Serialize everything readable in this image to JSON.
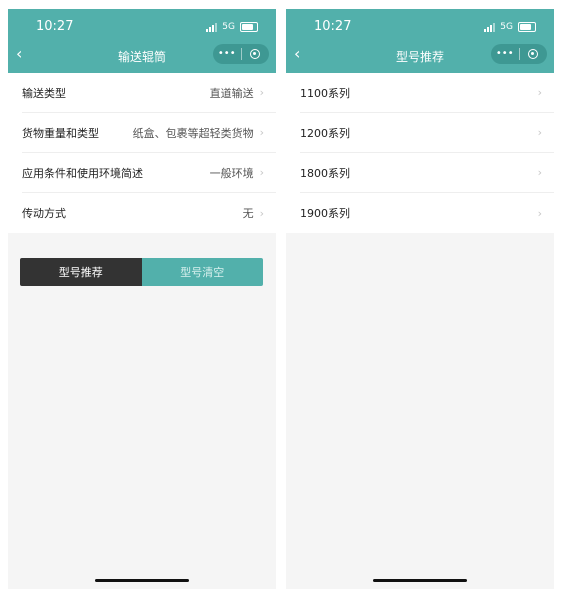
{
  "left": {
    "status_time": "10:27",
    "network": "5G",
    "title": "输送辊筒",
    "back_glyph": "‹",
    "capsule_dots": "•••",
    "rows": [
      {
        "label": "输送类型",
        "value": "直道输送"
      },
      {
        "label": "货物重量和类型",
        "value": "纸盒、包裹等超轻类货物"
      },
      {
        "label": "应用条件和使用环境简述",
        "value": "一般环境"
      },
      {
        "label": "传动方式",
        "value": "无"
      }
    ],
    "buttons": {
      "recommend": "型号推荐",
      "clear": "型号清空"
    }
  },
  "right": {
    "status_time": "10:27",
    "network": "5G",
    "title": "型号推荐",
    "back_glyph": "‹",
    "capsule_dots": "•••",
    "rows": [
      {
        "label": "1100系列"
      },
      {
        "label": "1200系列"
      },
      {
        "label": "1800系列"
      },
      {
        "label": "1900系列"
      }
    ]
  },
  "colors": {
    "header": "#52b0ab",
    "dark_button": "#333333",
    "teal_button": "#52b0ab",
    "background": "#f5f5f5"
  },
  "icons": {
    "chevron": "›"
  }
}
